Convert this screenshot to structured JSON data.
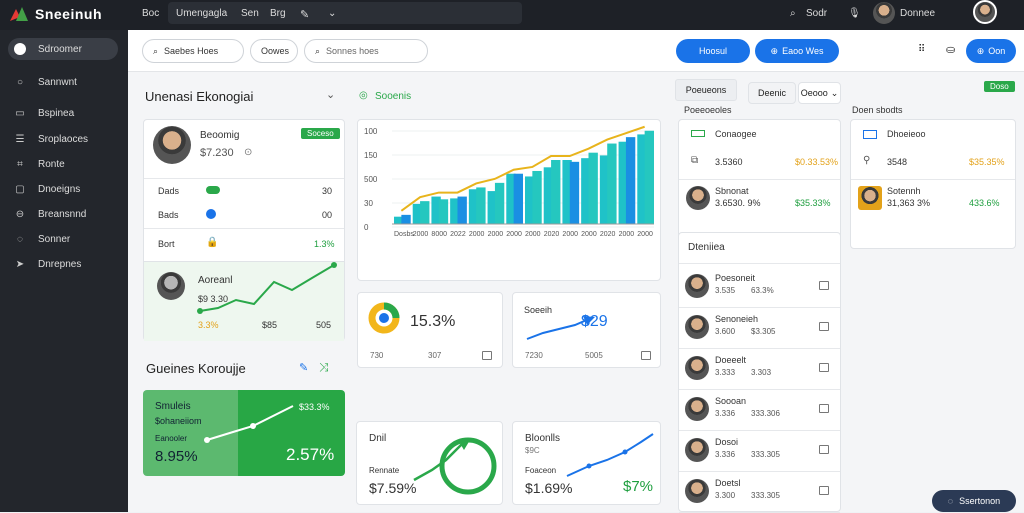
{
  "app": {
    "brand": "Sneeinuh"
  },
  "topbar": {
    "nav": [
      "Boc",
      "Umengagla",
      "Sen",
      "Brg"
    ],
    "right_label": "Sodr",
    "user_label": "Donnee"
  },
  "sidebar": {
    "items": [
      {
        "label": "Sdroomer",
        "icon": "circle-icon"
      },
      {
        "label": "Sannwnt",
        "icon": "circle-outline-icon"
      },
      {
        "label": "Bspinea",
        "icon": "monitor-icon"
      },
      {
        "label": "Sroplaoces",
        "icon": "list-icon"
      },
      {
        "label": "Ronte",
        "icon": "chart-icon"
      },
      {
        "label": "Dnoeigns",
        "icon": "doc-icon"
      },
      {
        "label": "Breansnnd",
        "icon": "settings-icon"
      },
      {
        "label": "Sonner",
        "icon": "chat-icon"
      },
      {
        "label": "Dnrepnes",
        "icon": "send-icon"
      }
    ]
  },
  "toolbar": {
    "filter1": "Saebes Hoes",
    "filter2": "Oowes",
    "search_placeholder": "Sonnes hoes",
    "btn1": "Hoosul",
    "btn2": "Eaoo Wes",
    "btn3": "Oon"
  },
  "section1": {
    "title": "Unenasi Ekonogiai",
    "filter": "Sooenis"
  },
  "profile_card": {
    "name": "Beoomig",
    "badge": "Soceso",
    "value": "$7.230",
    "rows": [
      {
        "label": "Dads",
        "value": "30",
        "color": "#2aa84a"
      },
      {
        "label": "Bads",
        "value": "00",
        "color": "#1a73e8"
      },
      {
        "label": "Bort",
        "value": "1.3%"
      }
    ],
    "sub_name": "Aoreanl",
    "sub_value": "$9 3.30",
    "stats": [
      "3.3%",
      "$85",
      "505"
    ]
  },
  "bar_chart": {
    "y_ticks": [
      "100",
      "150",
      "500",
      "30",
      "0"
    ],
    "first_label": "Dosbs",
    "x_labels": [
      "2000",
      "8000",
      "2022",
      "2000",
      "2000",
      "2000",
      "2000",
      "2020",
      "2000",
      "2000",
      "2020",
      "2000",
      "2000"
    ]
  },
  "chart_data": [
    {
      "type": "bar",
      "title": "",
      "categories": [
        "Dosbs",
        "2000",
        "8000",
        "2022",
        "2000",
        "2000",
        "2000",
        "2000",
        "2020",
        "2000",
        "2000",
        "2020",
        "2000",
        "2000"
      ],
      "series": [
        {
          "values": [
            8,
            22,
            30,
            28,
            38,
            36,
            55,
            52,
            62,
            70,
            72,
            75,
            90,
            98
          ]
        },
        {
          "values": [
            10,
            25,
            27,
            30,
            40,
            45,
            55,
            58,
            70,
            68,
            78,
            88,
            95,
            102
          ]
        }
      ],
      "y_ticks": [
        "100",
        "150",
        "500",
        "30",
        "0"
      ]
    }
  ],
  "kpi_donut": {
    "value": "15.3%",
    "footer": [
      "730",
      "307"
    ]
  },
  "kpi_line": {
    "title": "Soeeih",
    "value": "$29",
    "footer": [
      "7230",
      "5005"
    ]
  },
  "section2": {
    "title": "Gueines Koroujje"
  },
  "bottom_cards": [
    {
      "title": "Smuleis",
      "sub": "$ohaneiiom",
      "label": "Eanooler",
      "value": "8.95%",
      "value2": "$33.3%",
      "right_value": "2.57%"
    },
    {
      "title": "Dnil",
      "label": "Rennate",
      "value": "$7.59%"
    },
    {
      "title": "Bloonlls",
      "sub": "$9C",
      "label": "Foaceon",
      "value": "$1.69%",
      "right_value": "$7%"
    }
  ],
  "right_panel": {
    "tab1": "Poeueons",
    "tab2": "Deenic",
    "select": "Oeooo",
    "green_tag": "Doso",
    "col1_title": "Poeeoeoles",
    "col2_title": "Doen sbodts",
    "mini": [
      {
        "name": "Conaogee",
        "a": "3.5360",
        "b": "$0.33.53%"
      },
      {
        "name": "Sbnonat",
        "a": "3.6530. 9%",
        "b": "$35.33%"
      },
      {
        "name": "Dhoeieoo",
        "a": "3548",
        "b": "$35.35%"
      },
      {
        "name": "Sotennh",
        "a": "31,363 3%",
        "b": "433.6%"
      }
    ],
    "list_title": "Dteniiea",
    "list": [
      {
        "name": "Poesoneit",
        "a": "3.535",
        "b": "63.3%"
      },
      {
        "name": "Senoneieh",
        "a": "3.600",
        "b": "$3.305"
      },
      {
        "name": "Doeeelt",
        "a": "3.333",
        "b": "3.303"
      },
      {
        "name": "Soooan",
        "a": "3.336",
        "b": "333.306"
      },
      {
        "name": "Dosoi",
        "a": "3.336",
        "b": "333.305"
      },
      {
        "name": "Doetsl",
        "a": "3.300",
        "b": "333.305"
      }
    ]
  },
  "chat": {
    "label": "Ssertonon"
  }
}
